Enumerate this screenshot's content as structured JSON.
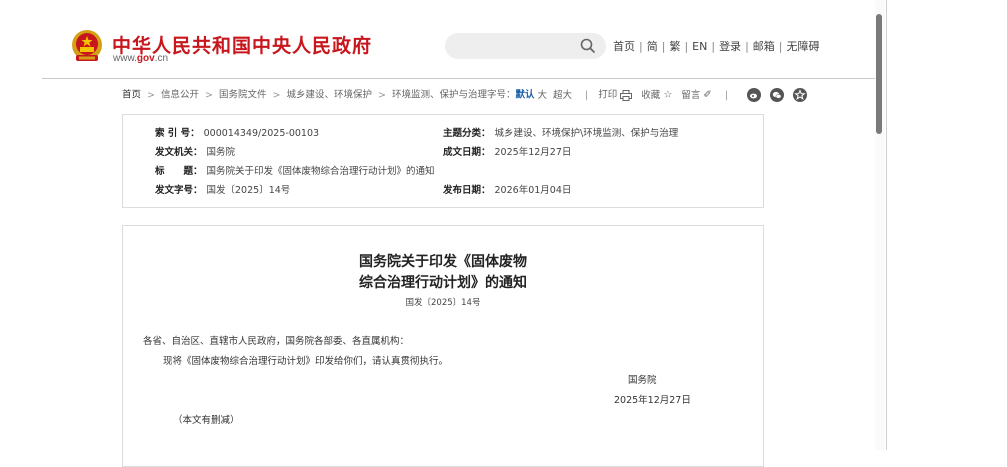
{
  "header": {
    "site_title": "中华人民共和国中央人民政府",
    "site_domain_pre": "www.",
    "site_domain_brand": "gov",
    "site_domain_post": ".cn",
    "search_placeholder": "",
    "nav": [
      "首页",
      "简",
      "繁",
      "EN",
      "登录",
      "邮箱",
      "无障碍"
    ],
    "nav_separator": "|"
  },
  "breadcrumb": {
    "items": [
      "首页",
      "信息公开",
      "国务院文件",
      "城乡建设、环境保护",
      "环境监测、保护与治理"
    ],
    "separator": ">",
    "font_label": "字号：",
    "font_sizes": [
      "默认",
      "大",
      "超大"
    ],
    "active_font": "默认",
    "print_label": "打印",
    "favorite_label": "收藏",
    "comment_label": "留言"
  },
  "info": {
    "index_label": "索 引 号：",
    "index_value": "000014349/2025-00103",
    "category_label": "主题分类：",
    "category_value": "城乡建设、环境保护\\环境监测、保护与治理",
    "issuer_label": "发文机关：",
    "issuer_value": "国务院",
    "created_label": "成文日期：",
    "created_value": "2025年12月27日",
    "title_label": "标　　题：",
    "title_value": "国务院关于印发《固体废物综合治理行动计划》的通知",
    "docno_label": "发文字号：",
    "docno_value": "国发〔2025〕14号",
    "published_label": "发布日期：",
    "published_value": "2026年01月04日"
  },
  "document": {
    "title_line1": "国务院关于印发《固体废物",
    "title_line2": "综合治理行动计划》的通知",
    "doc_number": "国发〔2025〕14号",
    "salutation": "各省、自治区、直辖市人民政府，国务院各部委、各直属机构：",
    "body": "现将《固体废物综合治理行动计划》印发给你们，请认真贯彻执行。",
    "signature": "国务院",
    "date": "2025年12月27日",
    "note": "（本文有删减）"
  },
  "colors": {
    "brand_red": "#c8161d",
    "link_blue": "#1d5ea8"
  }
}
